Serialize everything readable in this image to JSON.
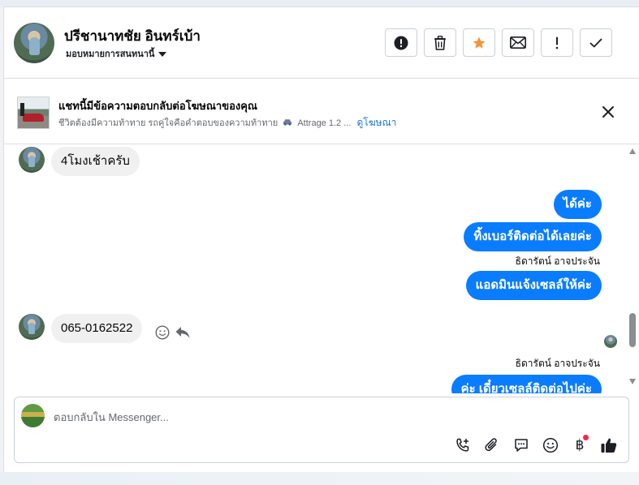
{
  "header": {
    "contact_name": "ปรีชานาทชัย อินทร์เบ้า",
    "label_select": "มอบหมายการสนทนานี้",
    "actions": [
      {
        "name": "spam-button",
        "icon": "exclamation-circle-icon"
      },
      {
        "name": "delete-button",
        "icon": "trash-icon"
      },
      {
        "name": "star-button",
        "icon": "star-icon"
      },
      {
        "name": "mark-unread-button",
        "icon": "envelope-icon"
      },
      {
        "name": "follow-up-button",
        "icon": "exclamation-icon"
      },
      {
        "name": "mark-done-button",
        "icon": "checkmark-icon"
      }
    ],
    "star_color": "#f7923b"
  },
  "ad_banner": {
    "title": "แชทนี้มีข้อความตอบกลับต่อโฆษณาของคุณ",
    "subtitle": "ชีวิตต้องมีความท้าทาย รถคู่ใจคือคำตอบของความท้าทาย",
    "car_icon": "car-icon",
    "subtitle_suffix": "Attrage 1.2 ...",
    "link": "ดูโฆษณา"
  },
  "messages": {
    "incoming_1": "4โมงเช้าครับ",
    "outgoing_1": "ได้ค่ะ",
    "outgoing_2": "ทิ้งเบอร์ติดต่อได้เลยค่ะ",
    "sender_1": "ธิดารัตน์ อาจประจัน",
    "outgoing_3": "แอดมินแจ้งเซลล์ให้ค่ะ",
    "incoming_2": "065-0162522",
    "sender_2": "ธิดารัตน์ อาจประจัน",
    "outgoing_4_partial": "ค่ะ เดี๋ยวเซลล์ติดต่อไปค่ะ"
  },
  "composer": {
    "placeholder": "ตอบกลับใน Messenger...",
    "tools": [
      "add-call-icon",
      "attachment-icon",
      "saved-reply-icon",
      "emoji-icon",
      "baht-payment-icon",
      "like-icon"
    ]
  },
  "colors": {
    "outgoing_bubble": "#0a7cff",
    "incoming_bubble": "#f0f0f0",
    "link": "#1876d2"
  }
}
